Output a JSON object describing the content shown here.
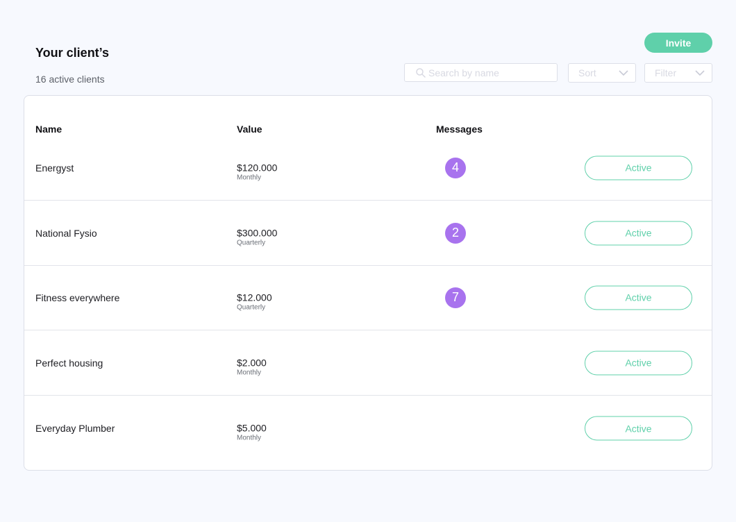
{
  "header": {
    "title": "Your client’s",
    "subtitle": "16 active clients"
  },
  "toolbar": {
    "invite_label": "Invite",
    "search_placeholder": "Search by name",
    "sort_label": "Sort",
    "filter_label": "Filter"
  },
  "table": {
    "columns": [
      "Name",
      "Value",
      "Messages"
    ],
    "rows": [
      {
        "name": "Energyst",
        "value": "$120.000",
        "period": "Monthly",
        "messages": "4",
        "status": "Active"
      },
      {
        "name": "National Fysio",
        "value": "$300.000",
        "period": "Quarterly",
        "messages": "2",
        "status": "Active"
      },
      {
        "name": "Fitness everywhere",
        "value": "$12.000",
        "period": "Quarterly",
        "messages": "7",
        "status": "Active"
      },
      {
        "name": "Perfect housing",
        "value": "$2.000",
        "period": "Monthly",
        "messages": "",
        "status": "Active"
      },
      {
        "name": "Everyday Plumber",
        "value": "$5.000",
        "period": "Monthly",
        "messages": "",
        "status": "Active"
      }
    ]
  },
  "icons": {
    "search": "search-icon",
    "sort_chevron": "chevron-down-icon",
    "filter_chevron": "chevron-down-icon"
  },
  "colors": {
    "accent": "#5fd0aa",
    "badge": "#a873ee",
    "background": "#f7f9fe"
  }
}
